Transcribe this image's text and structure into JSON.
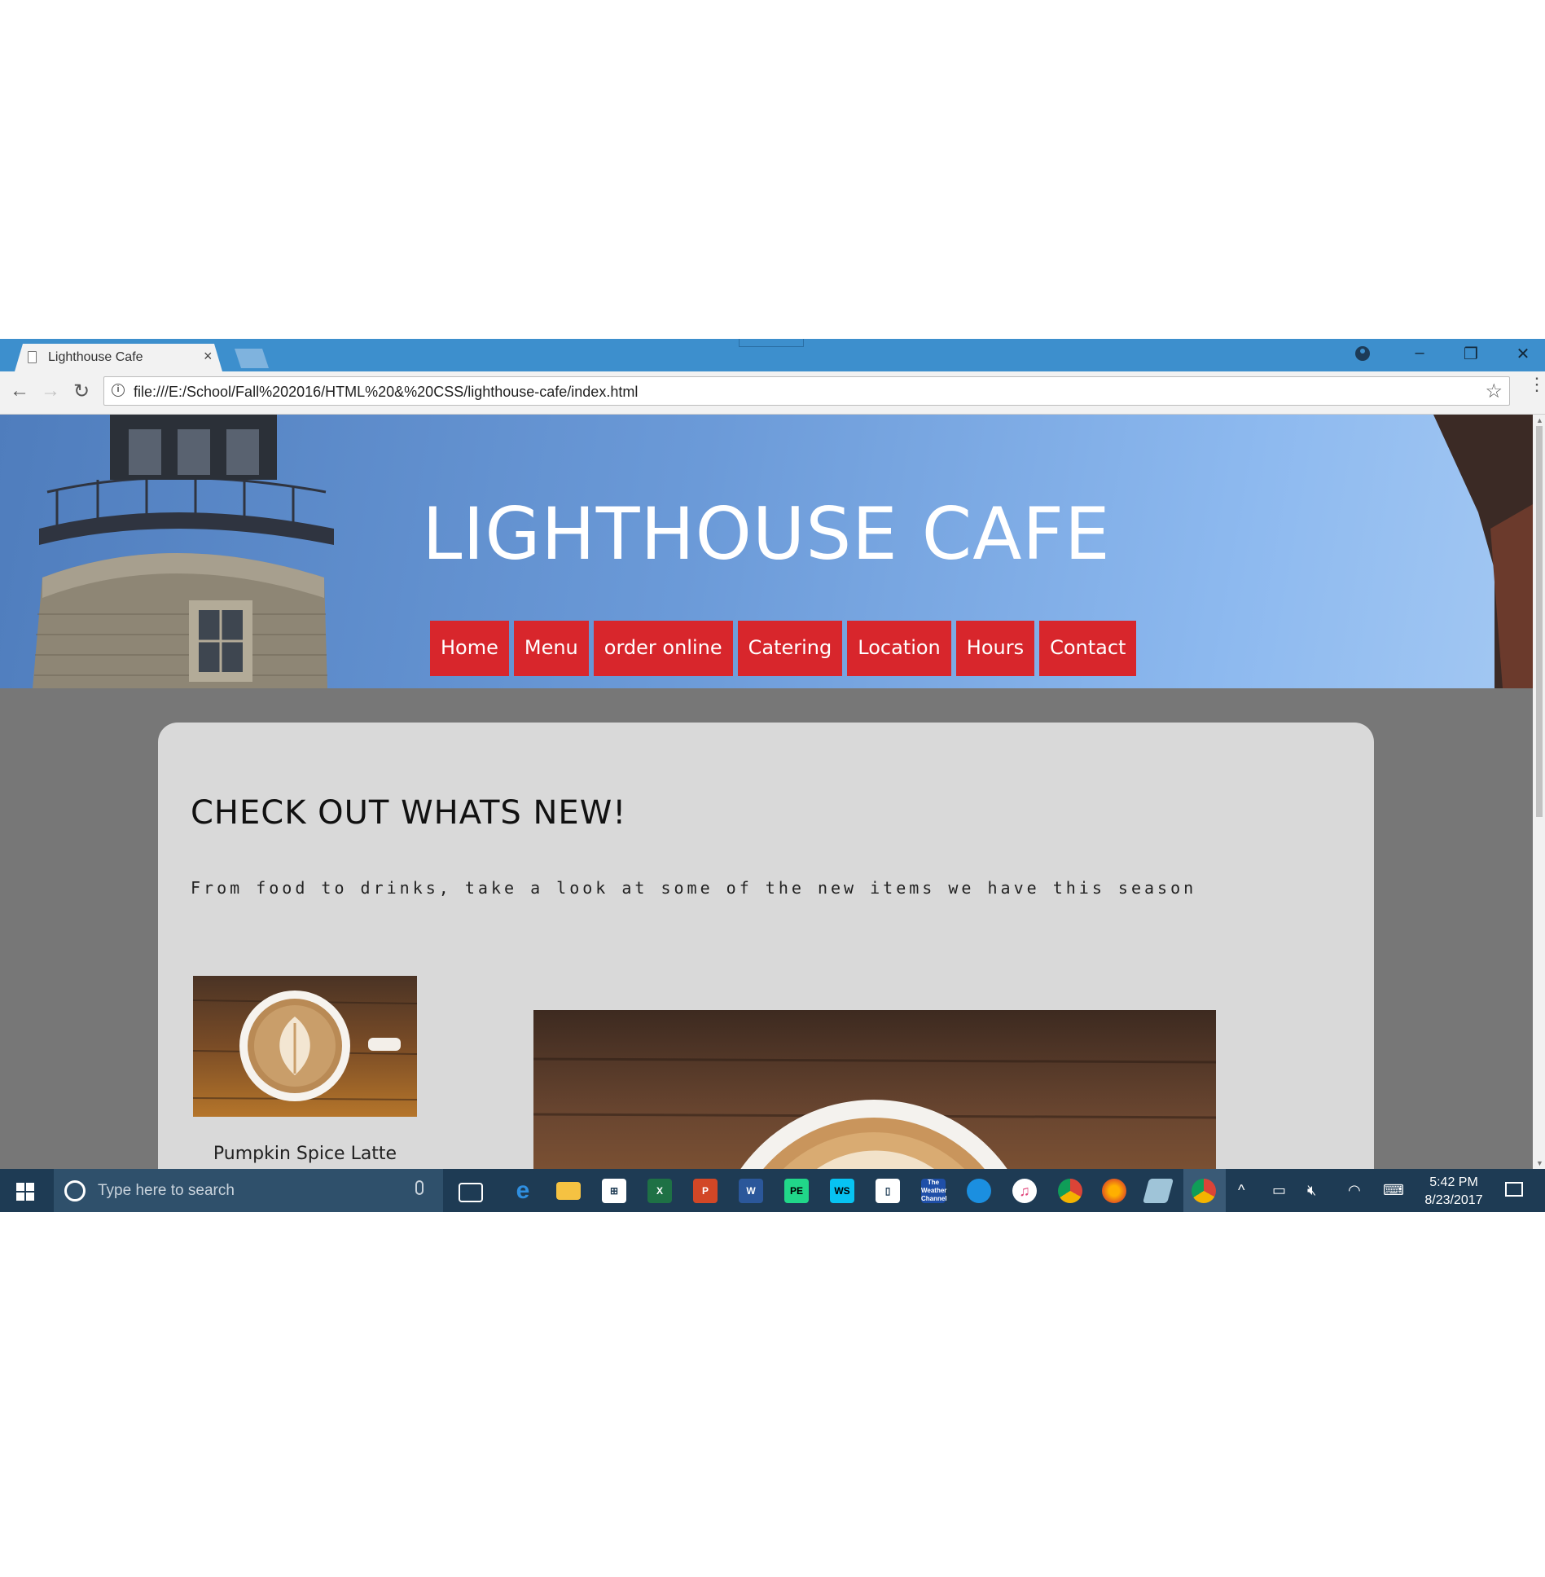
{
  "browser": {
    "tab_title": "Lighthouse Cafe",
    "tab_close": "×",
    "url": "file:///E:/School/Fall%202016/HTML%20&%20CSS/lighthouse-cafe/index.html",
    "window_buttons": {
      "minimize": "–",
      "restore": "❐",
      "close": "✕"
    },
    "nav": {
      "back": "←",
      "forward": "→",
      "reload": "↻",
      "star": "☆",
      "menu": "⋮",
      "info": "i"
    }
  },
  "site": {
    "title": "LIGHTHOUSE CAFE",
    "nav": [
      "Home",
      "Menu",
      "order online",
      "Catering",
      "Location",
      "Hours",
      "Contact"
    ],
    "heading": "CHECK OUT WHATS NEW!",
    "subheading": "From food to drinks, take a look at some of the new items we have this season",
    "item_caption": "Pumpkin Spice Latte",
    "nav_color": "#d8262c",
    "background_color": "#777777",
    "card_color": "#d9d9d9"
  },
  "taskbar": {
    "search_placeholder": "Type here to search",
    "time": "5:42 PM",
    "date": "8/23/2017",
    "pinned_icons": [
      "task-view-icon",
      "edge-icon",
      "file-explorer-icon",
      "store-icon",
      "excel-icon",
      "powerpoint-icon",
      "word-icon",
      "pycharm-icon",
      "webstorm-icon",
      "app-icon",
      "weather-channel-icon",
      "onedrive-icon",
      "itunes-icon",
      "chrome-icon",
      "firefox-icon",
      "app-icon-2",
      "chrome-active-icon"
    ],
    "tray": {
      "chevron": "^",
      "battery": "▭",
      "volume": "🔇︎",
      "wifi": "◠",
      "keyboard": "⌨"
    }
  }
}
